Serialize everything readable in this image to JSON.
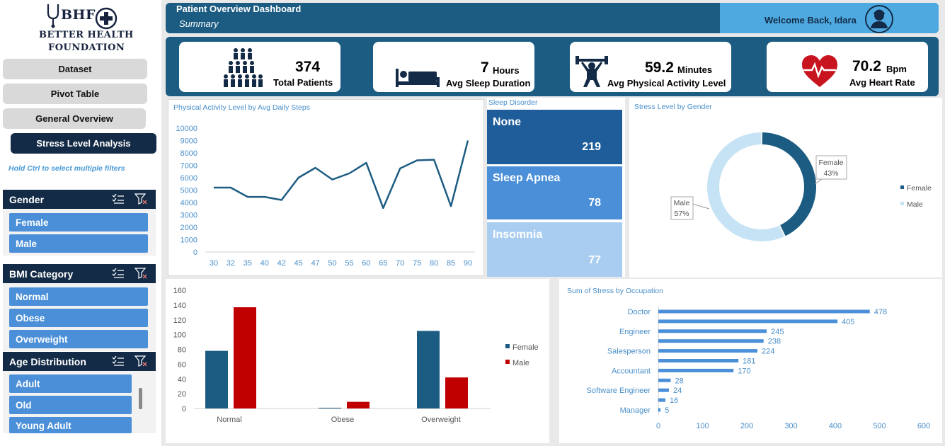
{
  "logo": {
    "abbr": "BHF",
    "line1": "BETTER HEALTH",
    "line2": "FOUNDATION"
  },
  "nav": [
    {
      "label": "Dataset"
    },
    {
      "label": "Pivot Table"
    },
    {
      "label": "General Overview"
    },
    {
      "label": "Stress Level Analysis",
      "active": true
    }
  ],
  "hint": "Hold Ctrl to select multiple filters",
  "slicers": {
    "gender": {
      "title": "Gender",
      "items": [
        "Female",
        "Male"
      ]
    },
    "bmi": {
      "title": "BMI Category",
      "items": [
        "Normal",
        "Obese",
        "Overweight"
      ]
    },
    "age": {
      "title": "Age Distribution",
      "items": [
        "Adult",
        "Old",
        "Young Adult"
      ]
    }
  },
  "header": {
    "title": "Patient Overview Dashboard",
    "subtitle": "Summary",
    "welcome": "Welcome Back, Idara"
  },
  "kpis": [
    {
      "value": "374",
      "unit": "",
      "label": "Total Patients",
      "icon": "people-group-icon"
    },
    {
      "value": "7",
      "unit": "Hours",
      "label": "Avg Sleep Duration",
      "icon": "bed-icon"
    },
    {
      "value": "59.2",
      "unit": "Minutes",
      "label": "Avg Physical Activity Level",
      "icon": "weightlifter-icon"
    },
    {
      "value": "70.2",
      "unit": "Bpm",
      "label": "Avg Heart Rate",
      "icon": "heart-pulse-icon"
    }
  ],
  "colors": {
    "navy": "#132b46",
    "blue": "#1d5c82",
    "accent": "#4a8fd8",
    "red": "#c00000",
    "light": "#c6e3f5"
  },
  "sleep": {
    "title": "Sleep Disorder",
    "tiles": [
      {
        "name": "None",
        "value": "219",
        "color": "#1f5d9a"
      },
      {
        "name": "Sleep Apnea",
        "value": "78",
        "color": "#4a8fd8"
      },
      {
        "name": "Insomnia",
        "value": "77",
        "color": "#a9cdf0"
      }
    ]
  },
  "chart_data": [
    {
      "type": "line",
      "title": "Physical Activity Level by Avg Daily Steps",
      "x": [
        "30",
        "32",
        "35",
        "40",
        "42",
        "45",
        "47",
        "50",
        "55",
        "60",
        "65",
        "70",
        "75",
        "80",
        "85",
        "90"
      ],
      "values": [
        5200,
        5200,
        4450,
        4450,
        4200,
        6000,
        6800,
        5850,
        6350,
        7200,
        3550,
        6750,
        7400,
        7450,
        3700,
        9000
      ],
      "ylim": [
        0,
        10000
      ],
      "yticks": [
        "10000",
        "9000",
        "8000",
        "7000",
        "6000",
        "5000",
        "4000",
        "3000",
        "2000",
        "1000",
        "0"
      ],
      "color": "#1d5c82"
    },
    {
      "type": "pie",
      "title": "Stress Level by Gender",
      "slices": [
        {
          "name": "Female",
          "value": 43,
          "label": "43%",
          "color": "#1d5c82"
        },
        {
          "name": "Male",
          "value": 57,
          "label": "57%",
          "color": "#c6e3f5"
        }
      ],
      "legend": "right"
    },
    {
      "type": "bar",
      "title": "",
      "categories": [
        "Normal",
        "Obese",
        "Overweight"
      ],
      "series": [
        {
          "name": "Female",
          "values": [
            78,
            1,
            105
          ],
          "color": "#1d5c82"
        },
        {
          "name": "Male",
          "values": [
            137,
            9,
            42
          ],
          "color": "#c00000"
        }
      ],
      "ylim": [
        0,
        160
      ],
      "yticks": [
        "160",
        "140",
        "120",
        "100",
        "80",
        "60",
        "40",
        "20",
        "0"
      ],
      "legend": "right"
    },
    {
      "type": "bar",
      "orientation": "horizontal",
      "title": "Sum of Stress by Occupation",
      "categories": [
        "Doctor",
        "",
        "Engineer",
        "",
        "Salesperson",
        "",
        "Accountant",
        "",
        "Software Engineer",
        "",
        "Manager"
      ],
      "values": [
        478,
        405,
        245,
        238,
        224,
        181,
        170,
        28,
        24,
        16,
        5
      ],
      "xlim": [
        0,
        600
      ],
      "xticks": [
        "0",
        "100",
        "200",
        "300",
        "400",
        "500",
        "600"
      ],
      "color": "#4a8fd8"
    }
  ]
}
